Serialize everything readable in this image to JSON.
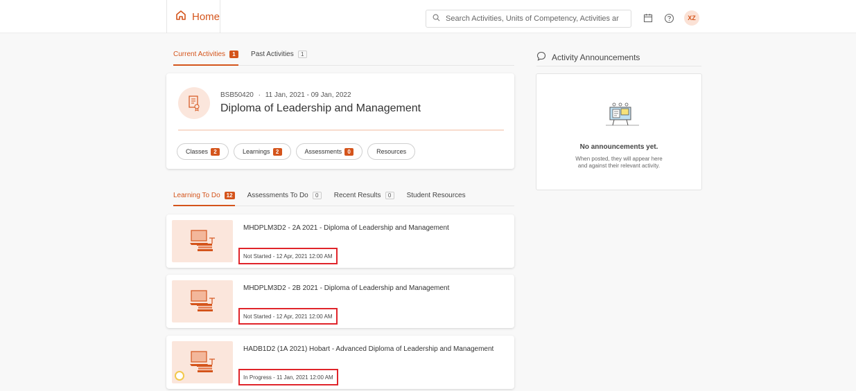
{
  "header": {
    "home_label": "Home",
    "search_placeholder": "Search Activities, Units of Competency, Activities and Res...",
    "avatar_initials": "XZ"
  },
  "activity_tabs": [
    {
      "label": "Current Activities",
      "count": "1"
    },
    {
      "label": "Past Activities",
      "count": "1"
    }
  ],
  "course": {
    "code": "BSB50420",
    "separator": "·",
    "dates": "11 Jan, 2021 - 09 Jan, 2022",
    "title": "Diploma of Leadership and Management",
    "pills": [
      {
        "label": "Classes",
        "count": "2"
      },
      {
        "label": "Learnings",
        "count": "2"
      },
      {
        "label": "Assessments",
        "count": "0"
      },
      {
        "label": "Resources",
        "count": ""
      }
    ]
  },
  "todo_tabs": [
    {
      "label": "Learning To Do",
      "count": "12"
    },
    {
      "label": "Assessments To Do",
      "count": "0"
    },
    {
      "label": "Recent Results",
      "count": "0"
    },
    {
      "label": "Student Resources",
      "count": ""
    }
  ],
  "learnings": [
    {
      "title": "MHDPLM3D2 - 2A 2021 - Diploma of Leadership and Management",
      "status": "Not Started - 12 Apr, 2021 12:00 AM"
    },
    {
      "title": "MHDPLM3D2 - 2B 2021 - Diploma of Leadership and Management",
      "status": "Not Started - 12 Apr, 2021 12:00 AM"
    },
    {
      "title": "HADB1D2 (1A 2021) Hobart - Advanced Diploma of Leadership and Management",
      "status": "In Progress - 11 Jan, 2021 12:00 AM"
    }
  ],
  "announcements": {
    "title": "Activity Announcements",
    "empty_heading": "No announcements yet.",
    "empty_line1": "When posted, they will appear here",
    "empty_line2": "and against their relevant activity."
  },
  "colors": {
    "accent": "#d4541b",
    "highlight_box": "#e0242a"
  },
  "icons": [
    "home-icon",
    "search-icon",
    "calendar-icon",
    "help-icon",
    "certificate-icon",
    "comment-icon",
    "laptop-books-icon"
  ]
}
